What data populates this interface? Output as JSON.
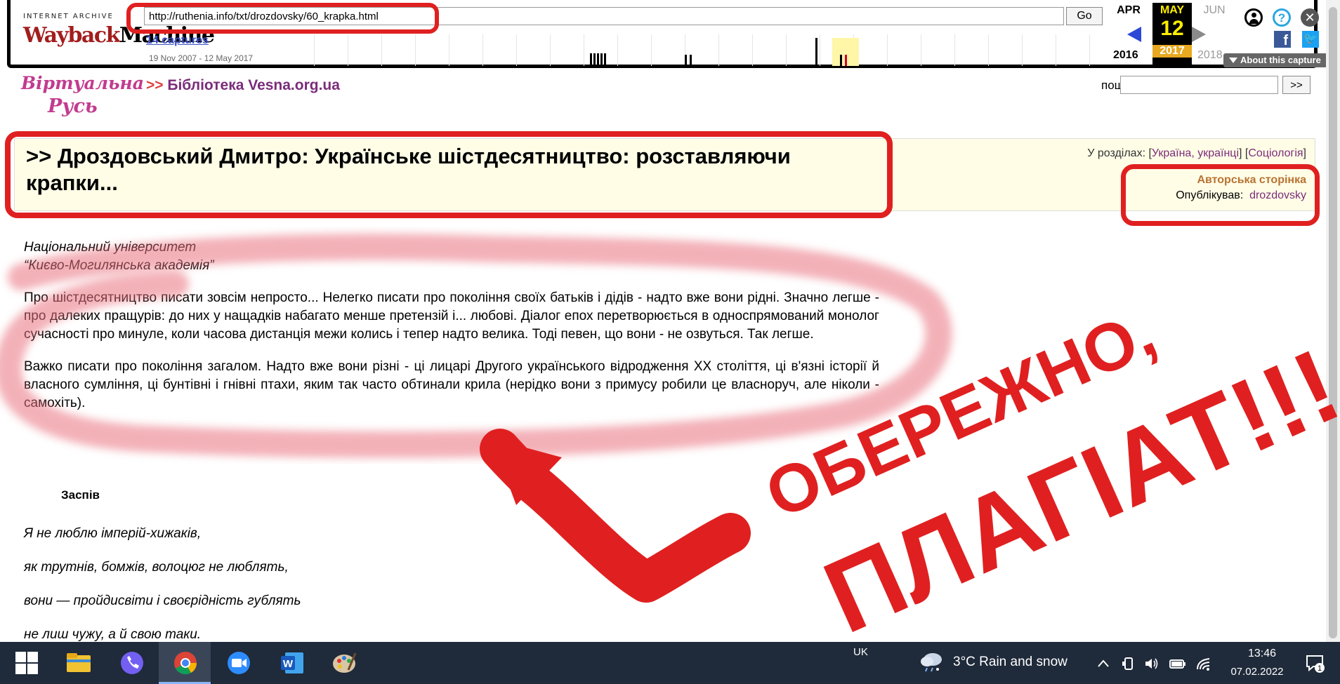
{
  "wayback": {
    "logo_top": "INTERNET ARCHIVE",
    "logo_way": "Wayback",
    "logo_machine": "Machine",
    "url_value": "http://ruthenia.info/txt/drozdovsky/60_krapka.html",
    "go_label": "Go",
    "captures": "14 captures",
    "range": "19 Nov 2007 - 12 May 2017",
    "prev_month": "APR",
    "cur_month": "MAY",
    "next_month": "JUN",
    "cur_day": "12",
    "prev_year": "2016",
    "cur_year": "2017",
    "next_year": "2018",
    "about": "About this capture"
  },
  "site": {
    "logo_line1": "Віртуальна",
    "logo_line2": "Русь",
    "crumb_pre": ">>",
    "crumb": "Бібліотека Vesna.org.ua",
    "search_label": "пошук:",
    "search_button": ">>"
  },
  "title_box": {
    "title": ">> Дроздовський Дмитро: Українське шістдесятництво: розставляючи крапки...",
    "sections_label": "У розділах:",
    "section1": "Україна, українці",
    "section2": "Соціологія",
    "author_page": "Авторська сторінка",
    "published_label": "Опублікував:",
    "published_by": "drozdovsky"
  },
  "article": {
    "uni_line1": "Національний університет",
    "uni_line2": "“Києво-Могилянська академія”",
    "para1": "Про шістдесятництво писати зовсім непросто... Нелегко писати про покоління своїх батьків і дідів - надто вже вони рідні. Значно легше - про далеких пращурів: до них у нащадків набагато менше претензій і... любові. Діалог епох перетворюється в односпрямований монолог сучасності про минуле, коли часова дистанція межи колись і тепер надто велика. Тоді певен, що вони - не озвуться. Так легше.",
    "para2": "Важко писати про покоління загалом. Надто вже вони різні - ці лицарі Другого українського відродження ХХ століття, ці в'язні історії й власного сумління, ці бунтівні і гнівні птахи, яким так часто обтинали крила (нерідко вони з примусу робили це власноруч, але ніколи - самохіть).",
    "poem_title": "Заспів",
    "poem": [
      "Я не люблю імперій-хижаків,",
      "як трутнів, бомжів, волоцюг не люблять,",
      "вони — пройдисвіти і своєрідність гублять",
      "не лиш чужу, а й свою таки."
    ]
  },
  "annotation": {
    "line1": "ОБЕРЕЖНО,",
    "line2": "ПЛАГІАТ!!!",
    "color": "#e02020"
  },
  "taskbar": {
    "lang": "UK",
    "weather": "3°C  Rain and snow",
    "time": "13:46",
    "date": "07.02.2022",
    "notif_count": "1"
  }
}
